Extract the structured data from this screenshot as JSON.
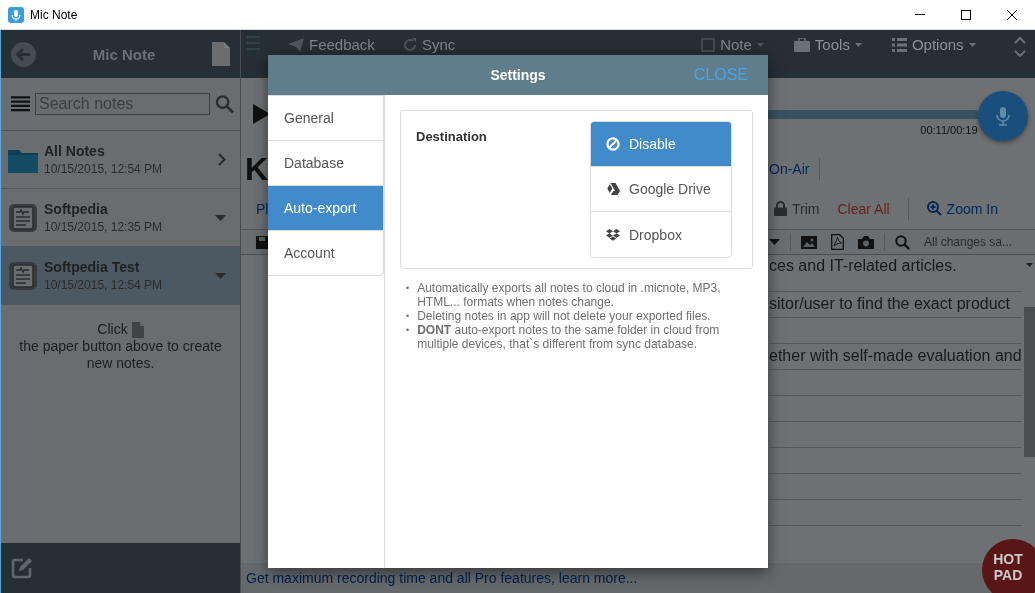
{
  "window": {
    "title": "Mic Note"
  },
  "sidebar": {
    "title": "Mic Note",
    "search": {
      "placeholder": "Search notes"
    },
    "notes": [
      {
        "kind": "folder",
        "title": "All Notes",
        "date": "10/15/2015, 12:54 PM",
        "selected": false
      },
      {
        "kind": "note",
        "title": "Softpedia",
        "date": "10/15/2015, 12:35 PM",
        "selected": false
      },
      {
        "kind": "note",
        "title": "Softpedia Test",
        "date": "10/15/2015, 12:54 PM",
        "selected": true
      }
    ],
    "hint": {
      "click": "Click",
      "text": "the paper button above to create new notes."
    }
  },
  "toolbar": {
    "items": [
      {
        "kind": "feedback",
        "label": "Feedback"
      },
      {
        "kind": "sync",
        "label": "Sync"
      }
    ],
    "menus": [
      {
        "kind": "note",
        "label": "Note"
      },
      {
        "kind": "tools",
        "label": "Tools"
      },
      {
        "kind": "options",
        "label": "Options"
      }
    ]
  },
  "player": {
    "level": 0.58,
    "time": "00:11/00:19"
  },
  "note": {
    "title": "K",
    "link_left": "Pl",
    "link_right": "On-Air"
  },
  "actions": [
    {
      "kind": "trim",
      "label": "Trim"
    },
    {
      "kind": "clear",
      "label": "Clear All"
    },
    {
      "kind": "zoom",
      "label": "Zoom In"
    }
  ],
  "editor": {
    "status": "All changes sa...",
    "lines": [
      "ces and IT-related articles.",
      "sitor/user to find the exact product",
      "ether with self-made evaluation and"
    ]
  },
  "banner": "Get maximum recording time and all Pro features, learn more...",
  "hot_pad": "HOT PAD",
  "settings": {
    "title": "Settings",
    "close": "CLOSE",
    "tabs": [
      {
        "label": "General",
        "selected": false
      },
      {
        "label": "Database",
        "selected": false
      },
      {
        "label": "Auto-export",
        "selected": true
      },
      {
        "label": "Account",
        "selected": false
      }
    ],
    "destination_label": "Destination",
    "destinations": [
      {
        "kind": "disable",
        "label": "Disable",
        "selected": true
      },
      {
        "kind": "gdrive",
        "label": "Google Drive",
        "selected": false
      },
      {
        "kind": "dropbox",
        "label": "Dropbox",
        "selected": false
      }
    ],
    "notes": [
      {
        "bullet": "•",
        "text": "Automatically exports all notes to cloud in .micnote, MP3, HTML... formats when notes change."
      },
      {
        "bullet": "•",
        "text": "Deleting notes in app will not delete your exported files."
      },
      {
        "bullet": "•",
        "text": "**DONT** auto-export notes to the same folder in cloud from multiple devices, that`s different from sync database."
      }
    ]
  }
}
